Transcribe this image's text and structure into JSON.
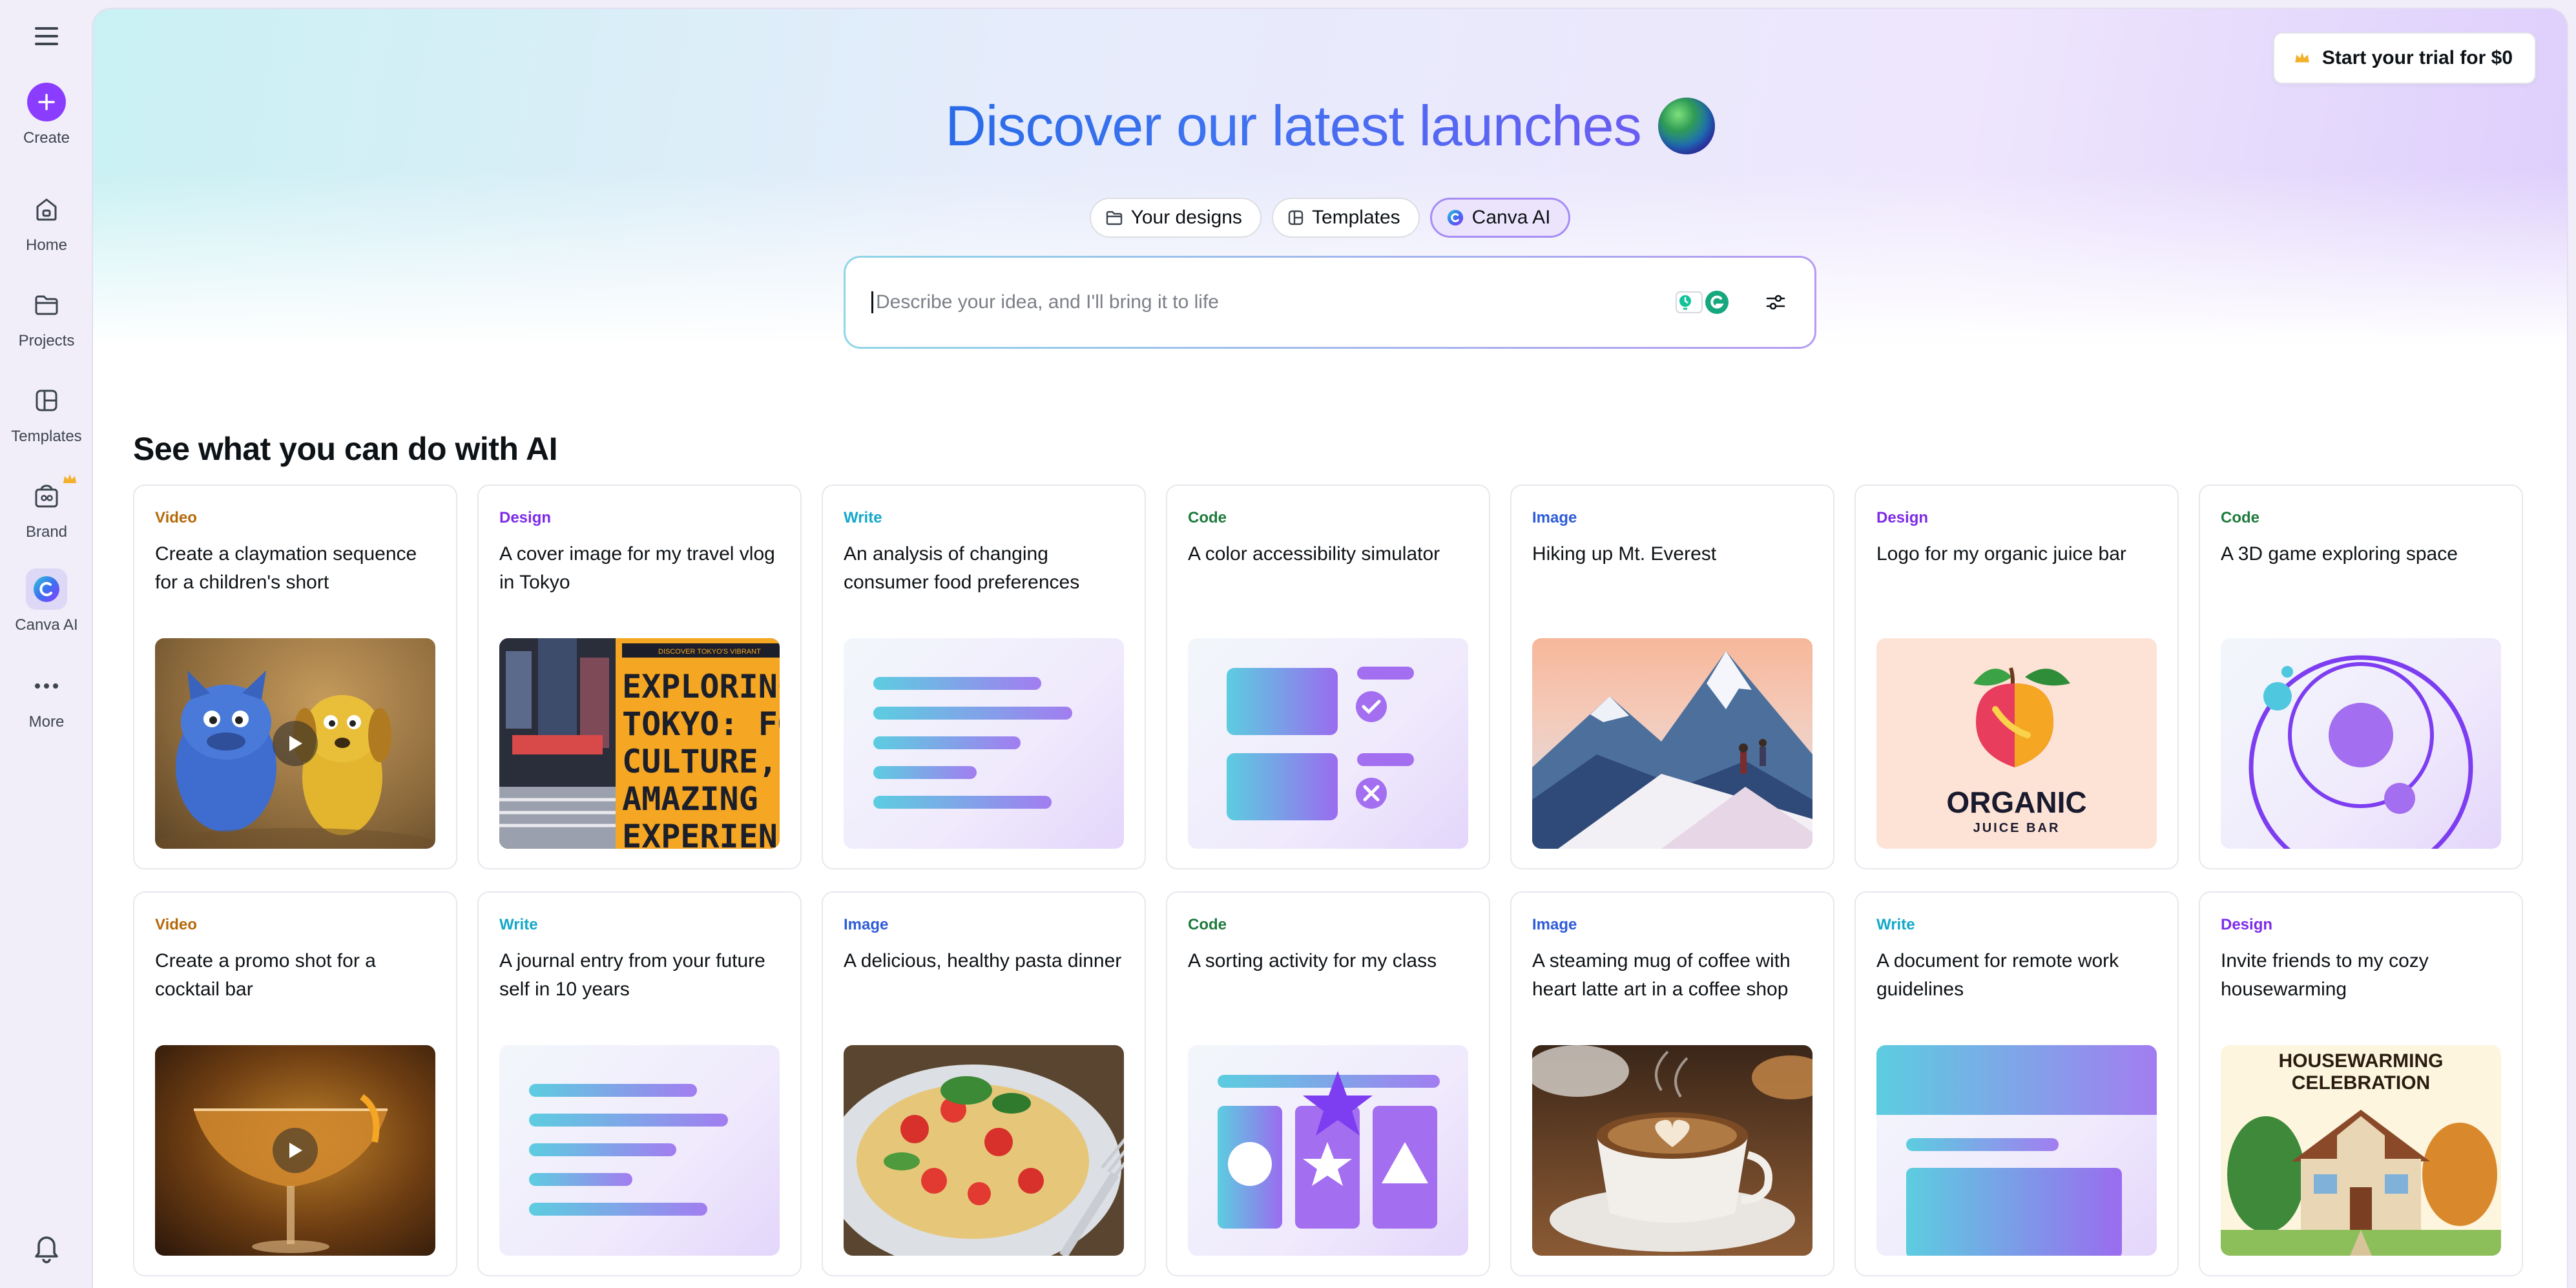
{
  "rail": {
    "items": [
      {
        "label": "Create",
        "icon": "plus-icon"
      },
      {
        "label": "Home",
        "icon": "home-icon"
      },
      {
        "label": "Projects",
        "icon": "folder-icon"
      },
      {
        "label": "Templates",
        "icon": "templates-icon"
      },
      {
        "label": "Brand",
        "icon": "brand-icon"
      },
      {
        "label": "Canva AI",
        "icon": "canva-ai-icon"
      },
      {
        "label": "More",
        "icon": "more-icon"
      }
    ],
    "active": "Canva AI"
  },
  "header": {
    "trial_label": "Start your trial for $0"
  },
  "hero": {
    "title": "Discover our latest launches",
    "tabs": [
      {
        "label": "Your designs",
        "icon": "folder-icon"
      },
      {
        "label": "Templates",
        "icon": "templates-icon"
      },
      {
        "label": "Canva AI",
        "icon": "canva-ai-icon",
        "active": true
      }
    ]
  },
  "prompt": {
    "placeholder": "Describe your idea, and I'll bring it to life"
  },
  "section": {
    "title": "See what you can do with AI"
  },
  "cards": [
    {
      "category": "Video",
      "text": "Create a claymation sequence for a children's short",
      "thumb": "claymation-video"
    },
    {
      "category": "Design",
      "text": "A cover image for my travel vlog in Tokyo",
      "thumb": "tokyo-cover",
      "thumb_text": "EXPLORING TOKYO: FO CULTURE, AMAZING EXPERIENC",
      "thumb_banner": "DISCOVER TOKYO'S VIBRANT"
    },
    {
      "category": "Write",
      "text": "An analysis of changing consumer food preferences",
      "thumb": "doc-lines"
    },
    {
      "category": "Code",
      "text": "A color accessibility simulator",
      "thumb": "code-checklist"
    },
    {
      "category": "Image",
      "text": "Hiking up Mt. Everest",
      "thumb": "mountain-image"
    },
    {
      "category": "Design",
      "text": "Logo for my organic juice bar",
      "thumb": "juice-logo",
      "thumb_text": "ORGANIC",
      "thumb_subtext": "JUICE BAR"
    },
    {
      "category": "Code",
      "text": "A 3D game exploring space",
      "thumb": "orbit-game"
    },
    {
      "category": "Video",
      "text": "Create a promo shot for a cocktail bar",
      "thumb": "cocktail-video"
    },
    {
      "category": "Write",
      "text": "A journal entry from your future self in 10 years",
      "thumb": "doc-lines"
    },
    {
      "category": "Image",
      "text": "A delicious, healthy pasta dinner",
      "thumb": "pasta-image"
    },
    {
      "category": "Code",
      "text": "A sorting activity for my class",
      "thumb": "sorting-shapes"
    },
    {
      "category": "Image",
      "text": "A steaming mug of coffee with heart latte art in a coffee shop",
      "thumb": "coffee-image"
    },
    {
      "category": "Write",
      "text": "A document for remote work guidelines",
      "thumb": "doc-banner"
    },
    {
      "category": "Design",
      "text": "Invite friends to my cozy housewarming",
      "thumb": "housewarming-invite",
      "thumb_text": "HOUSEWARMING CELEBRATION"
    }
  ],
  "colors": {
    "accent": "#8b3dff",
    "video": "#b5690b",
    "design": "#7d2ae8",
    "write": "#14a8c9",
    "code": "#1e7a3c",
    "image": "#2e5bd9"
  }
}
